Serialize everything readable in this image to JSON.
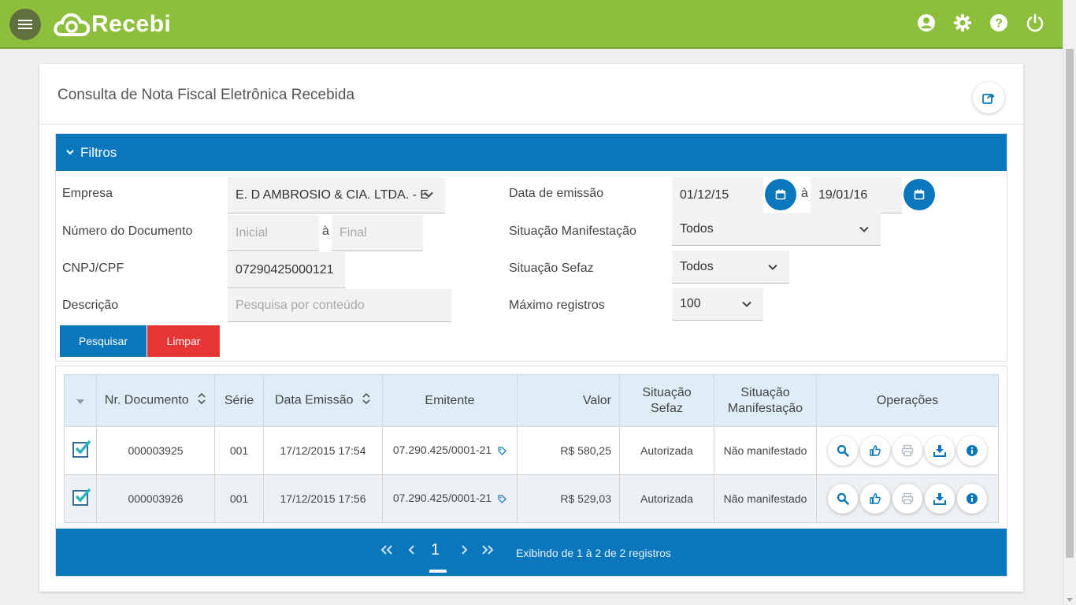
{
  "app": {
    "brand": "Recebi"
  },
  "page": {
    "title": "Consulta de Nota Fiscal Eletrônica Recebida"
  },
  "filters": {
    "header": "Filtros",
    "empresa": {
      "label": "Empresa",
      "value": "E. D AMBROSIO & CIA. LTDA. - E"
    },
    "numero_documento": {
      "label": "Número do Documento",
      "inicial_placeholder": "Inicial",
      "separator": "à",
      "final_placeholder": "Final"
    },
    "cnpj": {
      "label": "CNPJ/CPF",
      "value": "07290425000121"
    },
    "descricao": {
      "label": "Descrição",
      "placeholder": "Pesquisa por conteúdo"
    },
    "data_emissao": {
      "label": "Data de emissão",
      "from": "01/12/15",
      "separator": "à",
      "to": "19/01/16"
    },
    "situacao_manifestacao": {
      "label": "Situação Manifestação",
      "value": "Todos"
    },
    "situacao_sefaz": {
      "label": "Situação Sefaz",
      "value": "Todos"
    },
    "maximo_registros": {
      "label": "Máximo registros",
      "value": "100"
    },
    "search_button": "Pesquisar",
    "clear_button": "Limpar"
  },
  "table": {
    "columns": {
      "nr_documento": "Nr. Documento",
      "serie": "Série",
      "data_emissao": "Data Emissão",
      "emitente": "Emitente",
      "valor": "Valor",
      "situacao_sefaz_1": "Situação",
      "situacao_sefaz_2": "Sefaz",
      "situacao_manifestacao_1": "Situação",
      "situacao_manifestacao_2": "Manifestação",
      "operacoes": "Operações"
    },
    "rows": [
      {
        "nr_documento": "000003925",
        "serie": "001",
        "data_emissao": "17/12/2015 17:54",
        "emitente": "07.290.425/0001-21",
        "valor": "R$ 580,25",
        "situacao_sefaz": "Autorizada",
        "situacao_manifestacao": "Não manifestado"
      },
      {
        "nr_documento": "000003926",
        "serie": "001",
        "data_emissao": "17/12/2015 17:56",
        "emitente": "07.290.425/0001-21",
        "valor": "R$ 529,03",
        "situacao_sefaz": "Autorizada",
        "situacao_manifestacao": "Não manifestado"
      }
    ]
  },
  "pagination": {
    "current_page": "1",
    "info": "Exibindo de 1 à 2 de 2 registros"
  },
  "colors": {
    "topbar": "#8dbf3d",
    "primary": "#0a76bb",
    "danger": "#e53535"
  }
}
